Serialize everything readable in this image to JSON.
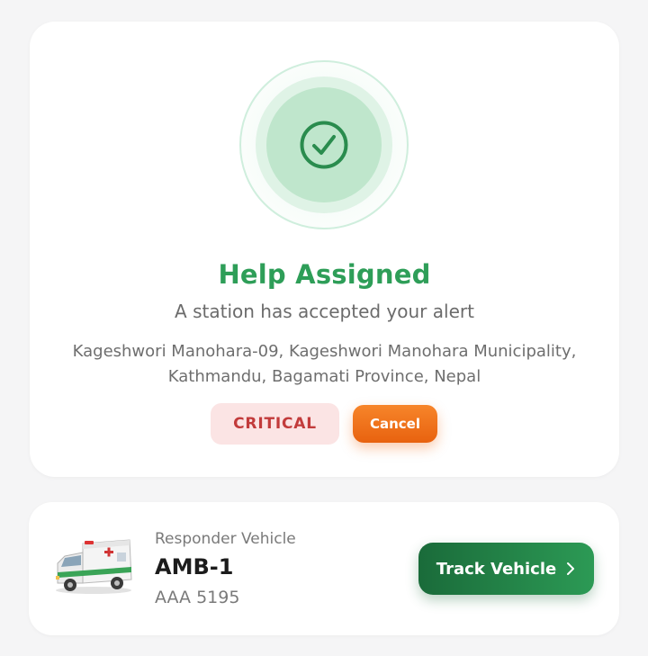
{
  "status": {
    "title": "Help Assigned",
    "subtitle": "A station has accepted your alert",
    "address_line1": "Kageshwori Manohara-09, Kageshwori Manohara Municipality,",
    "address_line2": "Kathmandu, Bagamati Province, Nepal",
    "priority_badge": "CRITICAL",
    "cancel_label": "Cancel",
    "icon": "check-circle-icon"
  },
  "vehicle": {
    "label": "Responder Vehicle",
    "id": "AMB-1",
    "plate": "AAA 5195",
    "track_label": "Track Vehicle",
    "image": "ambulance-image"
  },
  "colors": {
    "success": "#2e9e58",
    "critical_bg": "#fbe4e4",
    "critical_text": "#c23b3b",
    "cancel": "#f07a1f",
    "track": "#1f7a42"
  }
}
